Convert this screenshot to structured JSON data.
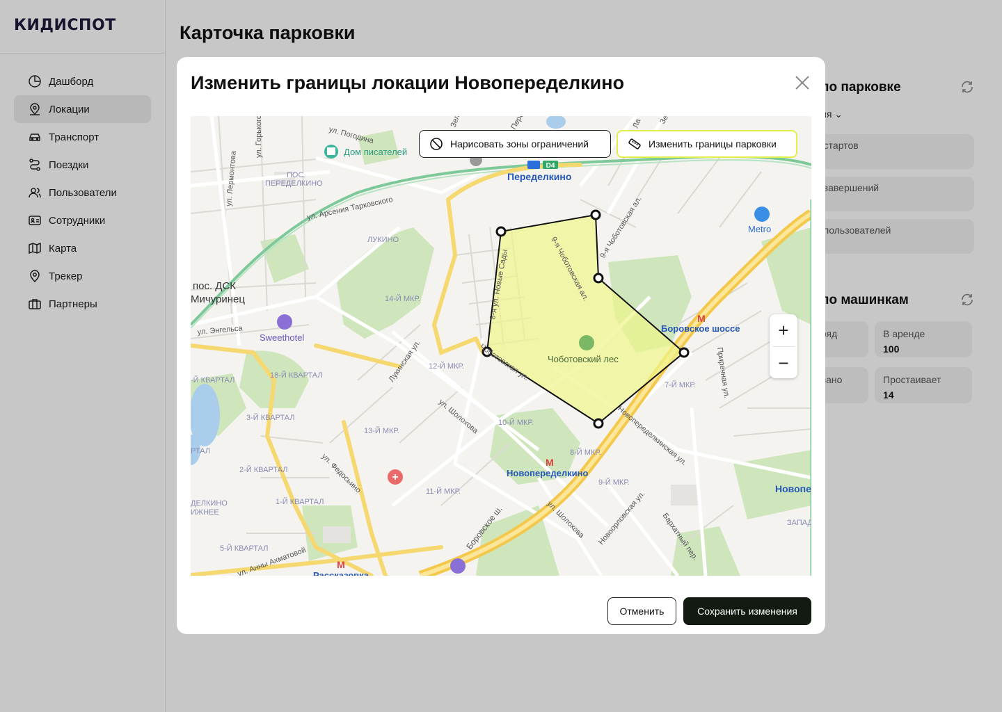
{
  "logo": "КИДИСПОТ",
  "sidebar": {
    "items": [
      {
        "label": "Дашборд",
        "icon": "chart-pie-icon"
      },
      {
        "label": "Локации",
        "icon": "location-pin-icon",
        "active": true
      },
      {
        "label": "Транспорт",
        "icon": "car-icon"
      },
      {
        "label": "Поездки",
        "icon": "route-icon"
      },
      {
        "label": "Пользователи",
        "icon": "users-icon"
      },
      {
        "label": "Сотрудники",
        "icon": "id-card-icon"
      },
      {
        "label": "Карта",
        "icon": "map-icon"
      },
      {
        "label": "Трекер",
        "icon": "map-pin-icon"
      },
      {
        "label": "Партнеры",
        "icon": "briefcase-icon"
      }
    ]
  },
  "page": {
    "title": "Карточка парковки"
  },
  "background_cards": {
    "parking": {
      "title": "по парковке",
      "select": "ия",
      "rows": [
        "о стартов",
        "о завершений",
        "о пользователей"
      ]
    },
    "cars": {
      "title": "по машинкам",
      "tiles": [
        {
          "label": "аряд",
          "value": ""
        },
        {
          "label": "В аренде",
          "value": "100"
        },
        {
          "label": "овано",
          "value": ""
        },
        {
          "label": "Простаивает",
          "value": "14"
        }
      ]
    }
  },
  "modal": {
    "title": "Изменить границы локации Новопеределкино",
    "draw_zones_label": "Нарисовать зоны ограничений",
    "edit_bounds_label": "Изменить границы парковки",
    "zoom_in": "+",
    "zoom_out": "−",
    "cancel_label": "Отменить",
    "save_label": "Сохранить изменения",
    "accent_color": "#e2ef4a",
    "polygon_fill": "#eef58a"
  },
  "map_labels": {
    "station_peredelkino": "Переделкино",
    "d4": "D4",
    "dom_pisatelei": "Дом писателей",
    "metro": "Metro",
    "borovskoe_shosse_station": "Боровское шоссе",
    "sweethotel": "Sweethotel",
    "novoperedelkino_station": "Новопеределкино",
    "rasskazovka": "Рассказовка",
    "novope_cut": "Новопе",
    "chobotovsky_les": "Чоботовский лес",
    "pos_dsk_line1": "пос. ДСК",
    "pos_dsk_line2": "Мичуринец",
    "pos_peredelkino_line1": "ПОС.",
    "pos_peredelkino_line2": "ПЕРЕДЕЛКИНО",
    "lukino": "ЛУКИНО",
    "mkr14": "14-Й МКР.",
    "mkr12": "12-Й МКР.",
    "mkr13": "13-Й МКР.",
    "mkr10": "10-Й МКР.",
    "mkr11": "11-Й МКР.",
    "mkr8": "8-Й МКР.",
    "mkr9": "9-Й МКР.",
    "mkr7": "7-Й МКР.",
    "kv18": "18-Й КВАРТАЛ",
    "kv3": "3-Й КВАРТАЛ",
    "kv2": "2-Й КВАРТАЛ",
    "kv1": "1-Й КВАРТАЛ",
    "kv5": "5-Й КВАРТАЛ",
    "kv_cut": "-Й КВАРТАЛ",
    "ртал": "РТАЛ",
    "zapadn": "ЗАПАДН",
    "delkino": "ДЕЛКИНО",
    "izhnee": "ИЖНЕЕ",
    "ul_pogodina": "ул. Погодина",
    "ul_gorkogo": "ул. Горького",
    "ul_lermontova": "ул. Лермонтова",
    "ul_tarkovskogo": "ул. Арсения Тарковского",
    "ul_engelsa": "ул. Энгельса",
    "lukinskaya": "Лукинская ул.",
    "chobotovskaya_9": "9-я Чоботовская ал.",
    "chobotovskaya_9b": "9-я Чоботовская ал.",
    "novye_sady": "8-я ул. Новые Сады",
    "chobotovskaya_ul": "Чоботовская ул.",
    "sholokhova": "ул. Шолохова",
    "sholokhova2": "ул. Шолохова",
    "fedosyino": "ул. Федосьино",
    "borovskoe_sh": "Боровское ш.",
    "novoperedelkinskaya": "Новопеределкинская ул.",
    "novoorlovskaya": "Новоорловская ул.",
    "barkhatny": "Бархатный пер.",
    "prirechnaya": "Приречная ул.",
    "akhmatovoy": "ул. Анны Ахматовой",
    "zel": "Зел",
    "peze": "Пере",
    "la": "Ла",
    "ze": "Зе"
  }
}
